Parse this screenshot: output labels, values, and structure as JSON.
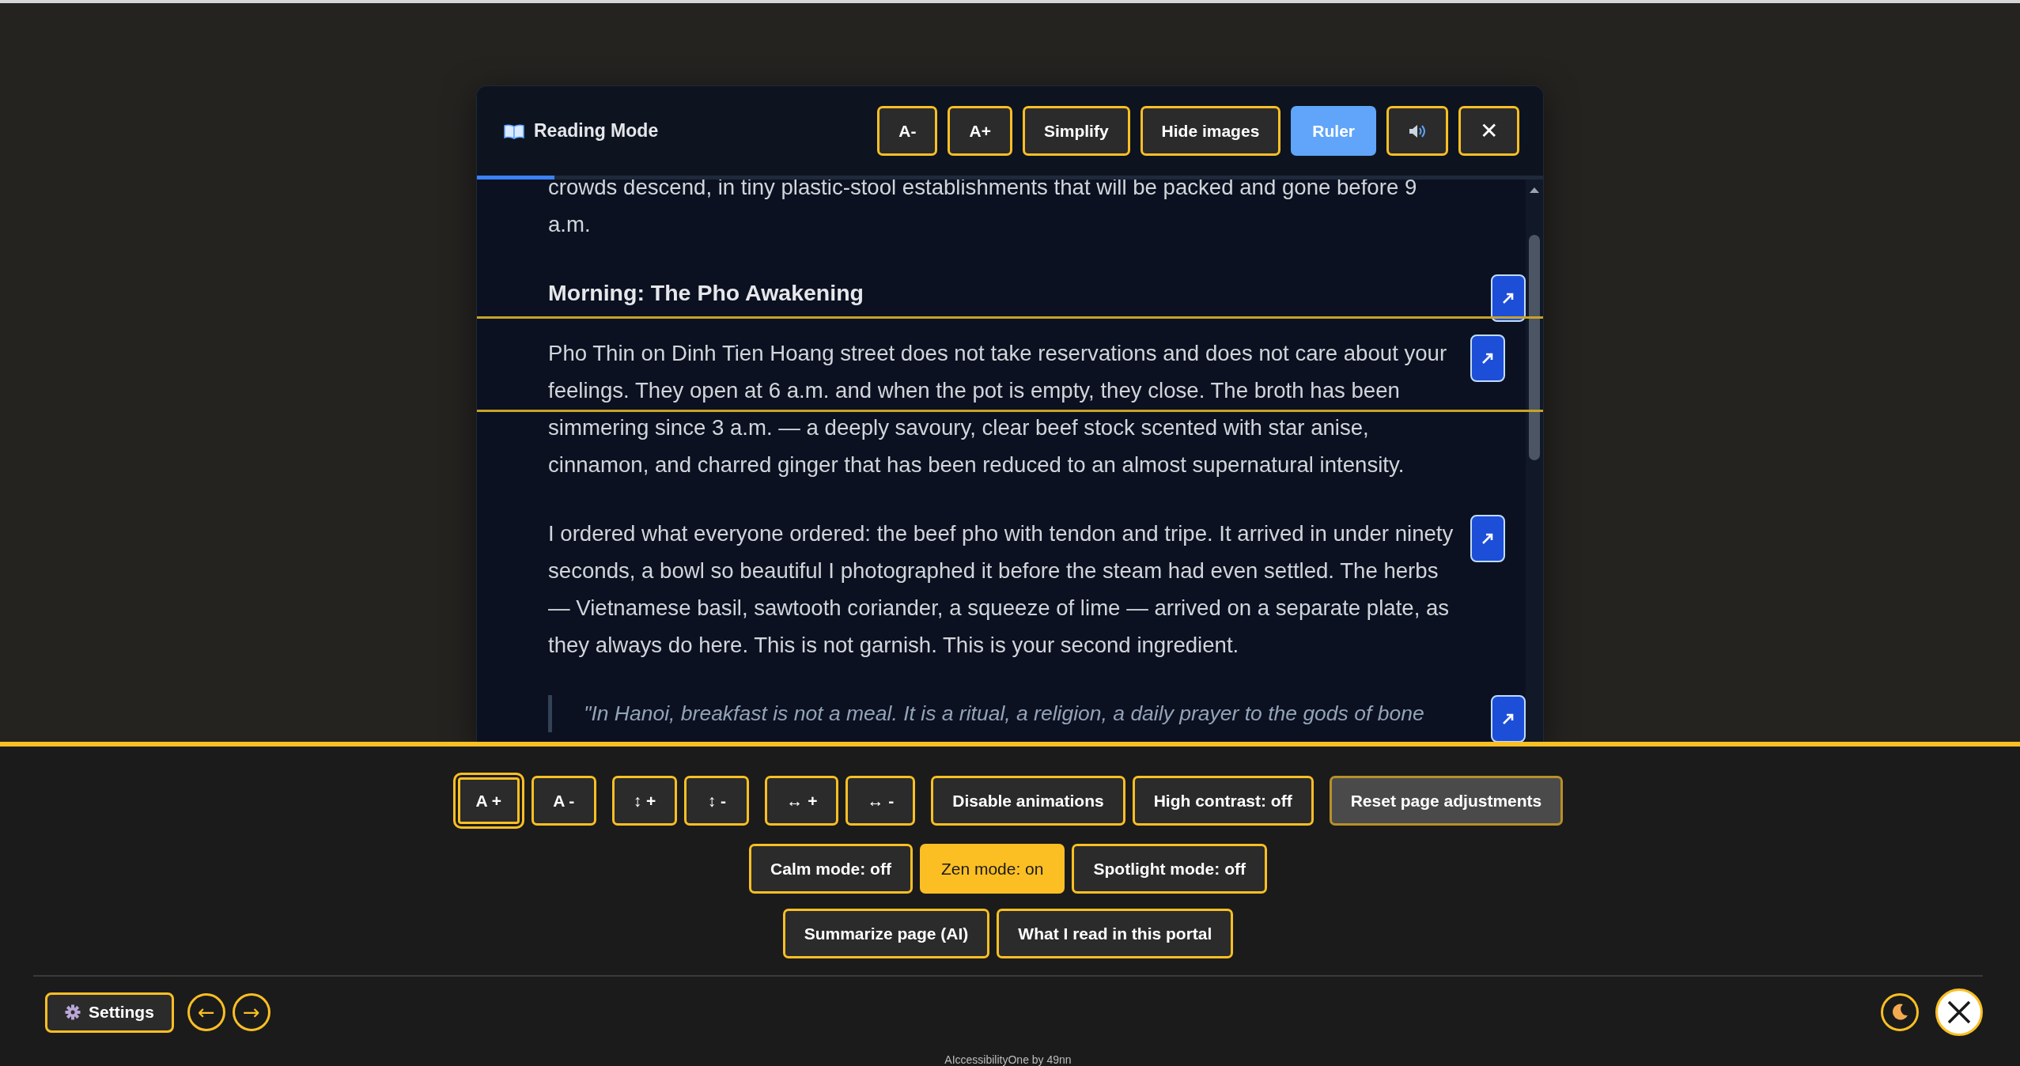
{
  "reading_mode": {
    "title": "Reading Mode",
    "toolbar": [
      {
        "kind": "text",
        "label": "A-",
        "selected": false
      },
      {
        "kind": "text",
        "label": "A+",
        "selected": false
      },
      {
        "kind": "text",
        "label": "Simplify",
        "selected": false
      },
      {
        "kind": "text",
        "label": "Hide images",
        "selected": false
      },
      {
        "kind": "ruler",
        "label": "Ruler",
        "selected": true
      },
      {
        "kind": "speaker",
        "selected": false
      },
      {
        "kind": "close",
        "label": "✕",
        "selected": false
      }
    ],
    "progress": {
      "level": 0.073
    },
    "content": [
      {
        "kind": "paragraph",
        "text": "crowds descend, in tiny plastic-stool establishments that will be packed and gone before 9 a.m.",
        "link_button": false
      },
      {
        "kind": "heading",
        "text": "Morning: The Pho Awakening",
        "link_button": true
      },
      {
        "kind": "paragraph",
        "text": "Pho Thin on Dinh Tien Hoang street does not take reservations and does not care about your feelings. They open at 6 a.m. and when the pot is empty, they close. The broth has been simmering since 3 a.m. — a deeply savoury, clear beef stock scented with star anise, cinnamon, and charred ginger that has been reduced to an almost supernatural intensity.",
        "link_button": true
      },
      {
        "kind": "paragraph",
        "text": "I ordered what everyone ordered: the beef pho with tendon and tripe. It arrived in under ninety seconds, a bowl so beautiful I photographed it before the steam had even settled. The herbs — Vietnamese basil, sawtooth coriander, a squeeze of lime — arrived on a separate plate, as they always do here. This is not garnish. This is your second ingredient.",
        "link_button": true
      },
      {
        "kind": "quote",
        "text": "\"In Hanoi, breakfast is not a meal. It is a ritual, a religion, a daily prayer to the gods of bone",
        "link_button": true
      }
    ]
  },
  "panel": {
    "rows": [
      {
        "groups": [
          [
            {
              "kind": "action",
              "label": "A +",
              "focused": true
            },
            {
              "kind": "action",
              "label": "A -",
              "focused": false
            }
          ],
          [
            {
              "kind": "action",
              "label": "↕ +",
              "focused": false
            },
            {
              "kind": "action",
              "label": "↕ -",
              "focused": false
            }
          ],
          [
            {
              "kind": "action",
              "label": "↔ +",
              "focused": false
            },
            {
              "kind": "action",
              "label": "↔ -",
              "focused": false
            }
          ],
          [
            {
              "kind": "action",
              "label": "Disable animations",
              "focused": false
            },
            {
              "kind": "toggle",
              "label": "High contrast: off",
              "on": false,
              "focused": false
            }
          ],
          [
            {
              "kind": "reset",
              "label": "Reset page adjustments",
              "focused": false
            }
          ]
        ]
      },
      {
        "groups": [
          [
            {
              "kind": "toggle",
              "label": "Calm mode: off",
              "on": false,
              "focused": false
            },
            {
              "kind": "toggle",
              "label": "Zen mode: on",
              "on": true,
              "focused": false
            },
            {
              "kind": "toggle",
              "label": "Spotlight mode: off",
              "on": false,
              "focused": false
            }
          ]
        ]
      },
      {
        "groups": [
          [
            {
              "kind": "action",
              "label": "Summarize page (AI)",
              "focused": false
            },
            {
              "kind": "action",
              "label": "What I read in this portal",
              "focused": false
            }
          ]
        ]
      }
    ],
    "footer": {
      "settings": "Settings",
      "back": "←",
      "forward": "→"
    },
    "credit": "AIccessibilityOne by 49nn"
  }
}
